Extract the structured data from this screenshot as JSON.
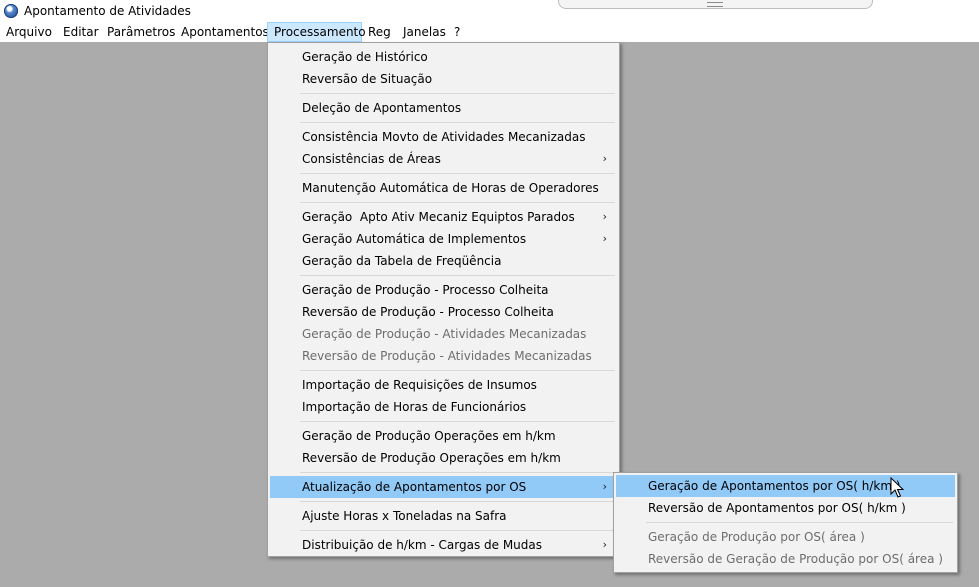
{
  "window": {
    "title": "Apontamento de Atividades"
  },
  "menubar": {
    "items": [
      {
        "label": "Arquivo"
      },
      {
        "label": "Editar"
      },
      {
        "label": "Parâmetros"
      },
      {
        "label": "Apontamentos"
      },
      {
        "label": "Processamento"
      },
      {
        "label": "Reg"
      },
      {
        "label": "Janelas"
      },
      {
        "label": "?"
      }
    ],
    "active": "Processamento"
  },
  "processamento_menu": {
    "items": [
      {
        "label": "Geração de Histórico"
      },
      {
        "label": "Reversão de Situação"
      },
      {
        "label": "Deleção de Apontamentos"
      },
      {
        "label": "Consistência Movto de Atividades Mecanizadas"
      },
      {
        "label": "Consistências de Áreas",
        "has_submenu": true
      },
      {
        "label": "Manutenção Automática de Horas de Operadores"
      },
      {
        "label": "Geração  Apto Ativ Mecaniz Equiptos Parados",
        "has_submenu": true
      },
      {
        "label": "Geração Automática de Implementos",
        "has_submenu": true
      },
      {
        "label": "Geração da Tabela de Freqüência"
      },
      {
        "label": "Geração de Produção - Processo Colheita"
      },
      {
        "label": "Reversão de Produção - Processo Colheita"
      },
      {
        "label": "Geração de Produção - Atividades Mecanizadas",
        "disabled": true
      },
      {
        "label": "Reversão de Produção - Atividades Mecanizadas",
        "disabled": true
      },
      {
        "label": "Importação de Requisições de Insumos"
      },
      {
        "label": "Importação de Horas de Funcionários"
      },
      {
        "label": "Geração de Produção Operações em h/km"
      },
      {
        "label": "Reversão de Produção Operações em h/km"
      },
      {
        "label": "Atualização de Apontamentos por OS",
        "has_submenu": true,
        "highlighted": true
      },
      {
        "label": "Ajuste Horas x Toneladas na Safra"
      },
      {
        "label": "Distribuição de h/km - Cargas de Mudas",
        "has_submenu": true
      }
    ]
  },
  "atualizacao_submenu": {
    "items": [
      {
        "label": "Geração de Apontamentos por OS( h/km )",
        "highlighted": true
      },
      {
        "label": "Reversão de Apontamentos por OS( h/km )"
      },
      {
        "label": "Geração de Produção por OS( área )",
        "disabled": true
      },
      {
        "label": "Reversão de Geração de Produção por OS( área )",
        "disabled": true
      }
    ]
  },
  "icons": {
    "app": "app-globe-icon",
    "submenu": "chevron-right-icon",
    "cursor": "mouse-pointer-icon"
  },
  "colors": {
    "highlight": "#91c9f7",
    "menubar_active": "#cce8ff",
    "workspace": "#ababab",
    "menu_background": "#f2f2f2",
    "disabled_text": "#6d6d6d"
  }
}
